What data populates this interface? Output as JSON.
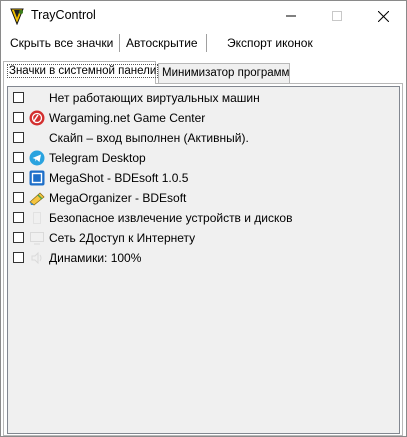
{
  "window": {
    "title": "TrayControl"
  },
  "toolbar": {
    "hide_all": "Скрыть все значки",
    "autohide": "Автоскрытие",
    "export_icons": "Экспорт иконок"
  },
  "tabs": [
    {
      "label": "Значки в системной панели",
      "active": true
    },
    {
      "label": "Минимизатор программ",
      "active": false
    }
  ],
  "tray_items": [
    {
      "label": "Нет работающих виртуальных машин",
      "checked": false,
      "icon": "blank-icon"
    },
    {
      "label": "Wargaming.net Game Center",
      "checked": false,
      "icon": "wargaming-icon"
    },
    {
      "label": "Скайп – вход выполнен (Активный).",
      "checked": false,
      "icon": "blank-icon"
    },
    {
      "label": "Telegram Desktop",
      "checked": false,
      "icon": "telegram-icon"
    },
    {
      "label": "MegaShot - BDEsoft 1.0.5",
      "checked": false,
      "icon": "megashot-icon"
    },
    {
      "label": "MegaOrganizer - BDEsoft",
      "checked": false,
      "icon": "megaorganizer-icon"
    },
    {
      "label": "Безопасное извлечение устройств и дисков",
      "checked": false,
      "icon": "usb-eject-icon"
    },
    {
      "label": "Сеть 2Доступ к Интернету",
      "checked": false,
      "icon": "network-icon"
    },
    {
      "label": "Динамики: 100%",
      "checked": false,
      "icon": "speaker-icon"
    }
  ],
  "colors": {
    "wargaming": "#d32f2f",
    "telegram": "#2aa3df",
    "megashot": "#1e6fc9"
  }
}
